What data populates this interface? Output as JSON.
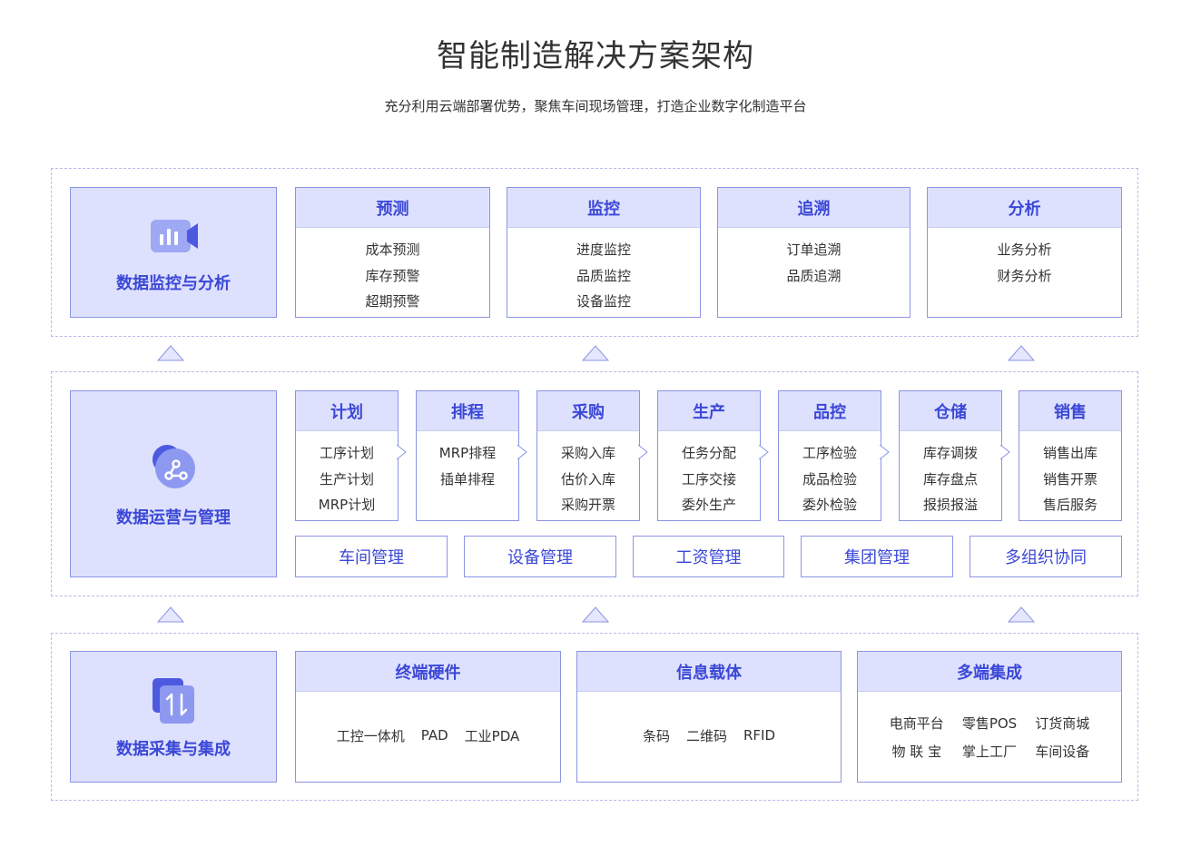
{
  "page": {
    "title": "智能制造解决方案架构",
    "subtitle": "充分利用云端部署优势，聚焦车间现场管理，打造企业数字化制造平台"
  },
  "colors": {
    "accent": "#3b48d6",
    "header_bg": "#dee1fd",
    "border": "#8c95e4",
    "dash": "#b6bcec"
  },
  "layer_top": {
    "label": "数据监控与分析",
    "icon": "video-chart-icon",
    "cards": [
      {
        "title": "预测",
        "items": [
          "成本预测",
          "库存预警",
          "超期预警"
        ]
      },
      {
        "title": "监控",
        "items": [
          "进度监控",
          "品质监控",
          "设备监控"
        ]
      },
      {
        "title": "追溯",
        "items": [
          "订单追溯",
          "品质追溯"
        ]
      },
      {
        "title": "分析",
        "items": [
          "业务分析",
          "财务分析"
        ]
      }
    ]
  },
  "layer_mid": {
    "label": "数据运营与管理",
    "icon": "share-nodes-icon",
    "cards": [
      {
        "title": "计划",
        "items": [
          "工序计划",
          "生产计划",
          "MRP计划"
        ]
      },
      {
        "title": "排程",
        "items": [
          "MRP排程",
          "插单排程"
        ]
      },
      {
        "title": "采购",
        "items": [
          "采购入库",
          "估价入库",
          "采购开票"
        ]
      },
      {
        "title": "生产",
        "items": [
          "任务分配",
          "工序交接",
          "委外生产"
        ]
      },
      {
        "title": "品控",
        "items": [
          "工序检验",
          "成品检验",
          "委外检验"
        ]
      },
      {
        "title": "仓储",
        "items": [
          "库存调拨",
          "库存盘点",
          "报损报溢"
        ]
      },
      {
        "title": "销售",
        "items": [
          "销售出库",
          "销售开票",
          "售后服务"
        ]
      }
    ],
    "modules": [
      "车间管理",
      "设备管理",
      "工资管理",
      "集团管理",
      "多组织协同"
    ]
  },
  "layer_bot": {
    "label": "数据采集与集成",
    "icon": "transfer-arrows-icon",
    "cards": [
      {
        "title": "终端硬件",
        "items": [
          "工控一体机",
          "PAD",
          "工业PDA"
        ]
      },
      {
        "title": "信息载体",
        "items": [
          "条码",
          "二维码",
          "RFID"
        ]
      },
      {
        "title": "多端集成",
        "items": [
          "电商平台",
          "零售POS",
          "订货商城",
          "物 联 宝",
          "掌上工厂",
          "车间设备"
        ]
      }
    ]
  }
}
